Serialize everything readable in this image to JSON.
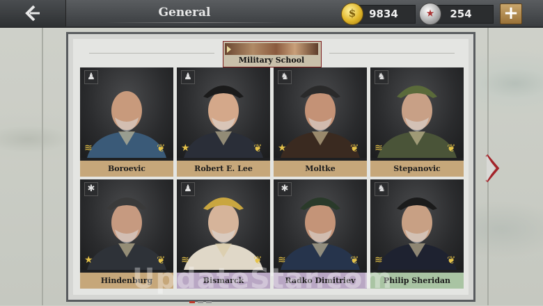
{
  "header": {
    "title": "General",
    "gold": "9834",
    "medals": "254",
    "plus_label": "+"
  },
  "banner": {
    "label": "Military School"
  },
  "generals": [
    {
      "name": "Boroevic",
      "type_icon": "infantry-icon",
      "rank": "chevron-rank-icon",
      "name_color": "gold"
    },
    {
      "name": "Robert E. Lee",
      "type_icon": "infantry-icon",
      "rank": "star-rank-icon",
      "name_color": "gold"
    },
    {
      "name": "Moltke",
      "type_icon": "cavalry-icon",
      "rank": "star-rank-icon",
      "name_color": "gold"
    },
    {
      "name": "Stepanovic",
      "type_icon": "cavalry-icon",
      "rank": "chevron-rank-icon",
      "name_color": "gold"
    },
    {
      "name": "Hindenburg",
      "type_icon": "artillery-icon",
      "rank": "star-rank-icon",
      "name_color": "gold"
    },
    {
      "name": "Bismarck",
      "type_icon": "infantry-icon",
      "rank": "chevron-rank-icon",
      "name_color": "purple"
    },
    {
      "name": "Radko Dimitriev",
      "type_icon": "artillery-icon",
      "rank": "chevron-rank-icon",
      "name_color": "purple"
    },
    {
      "name": "Philip Sheridan",
      "type_icon": "cavalry-icon",
      "rank": "chevron-rank-icon",
      "name_color": "green"
    }
  ],
  "pagination": {
    "pages": 3,
    "current": 1
  },
  "watermark": "UpdateStar.com",
  "colors": {
    "gold_name_bg": "#c6a77a",
    "purple_name_bg": "#b9a7c4",
    "green_name_bg": "#a9c4a3",
    "accent_red": "#c0392b"
  }
}
